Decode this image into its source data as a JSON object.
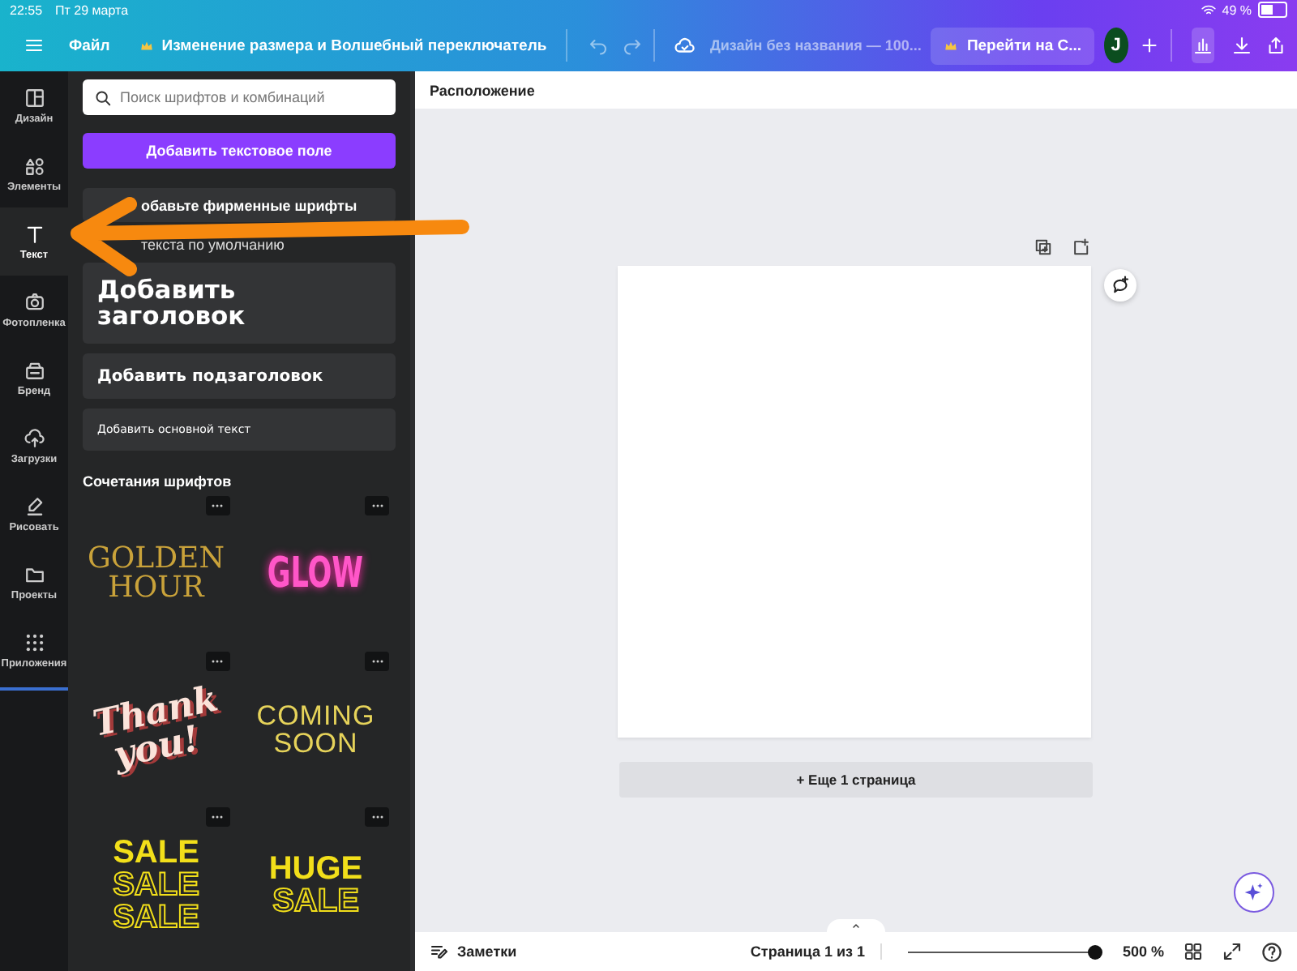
{
  "status_bar": {
    "time": "22:55",
    "date": "Пт 29 марта",
    "battery": "49 %"
  },
  "toolbar": {
    "file_menu": "Файл",
    "resize_title": "Изменение размера и Волшебный переключатель",
    "design_name": "Дизайн без названия — 100...",
    "upgrade_button": "Перейти на С...",
    "avatar": "J"
  },
  "rail": [
    {
      "label": "Дизайн",
      "selected": false
    },
    {
      "label": "Элементы",
      "selected": false
    },
    {
      "label": "Текст",
      "selected": true
    },
    {
      "label": "Фотопленка",
      "selected": false
    },
    {
      "label": "Бренд",
      "selected": false
    },
    {
      "label": "Загрузки",
      "selected": false
    },
    {
      "label": "Рисовать",
      "selected": false
    },
    {
      "label": "Проекты",
      "selected": false
    },
    {
      "label": "Приложения",
      "selected": false
    }
  ],
  "panel": {
    "search": {
      "placeholder": "Поиск шрифтов и комбинаций"
    },
    "add_button": "Добавить текстовое поле",
    "brand_fonts": "обавьте фирменные шрифты",
    "default_styles_label": "текста по умолчанию",
    "text_styles": [
      {
        "kind": "heading",
        "label": "Добавить заголовок"
      },
      {
        "kind": "subheading",
        "label": "Добавить подзаголовок"
      },
      {
        "kind": "body",
        "label": "Добавить основной текст"
      }
    ],
    "combos_label": "Сочетания шрифтов",
    "combos": [
      {
        "kind": "serif",
        "lines": [
          "GOLDEN",
          "HOUR"
        ]
      },
      {
        "kind": "neon",
        "lines": [
          "GLOW"
        ]
      },
      {
        "kind": "script",
        "lines": [
          "Thank",
          "you!"
        ]
      },
      {
        "kind": "thin",
        "lines": [
          "COMING",
          "SOON"
        ]
      },
      {
        "kind": "stack",
        "lines": [
          "SALE",
          "SALE",
          "SALE"
        ]
      },
      {
        "kind": "stack",
        "lines": [
          "HUGE",
          "SALE"
        ]
      }
    ]
  },
  "canvas": {
    "header": "Расположение",
    "add_page": "+ Еще 1 страница"
  },
  "footer": {
    "notes": "Заметки",
    "page_indicator": "Страница 1 из 1",
    "zoom": {
      "level": 1,
      "reading": "500 %"
    }
  }
}
